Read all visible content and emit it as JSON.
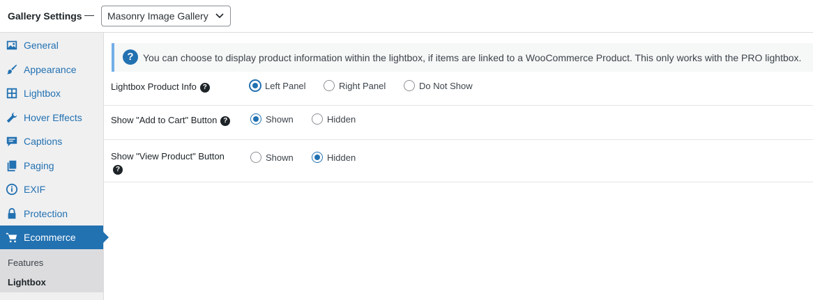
{
  "header": {
    "title": "Gallery Settings",
    "separator": "—",
    "gallery_select": {
      "value": "Masonry Image Gallery",
      "icon": "chevron-down-icon"
    }
  },
  "sidebar": {
    "items": [
      {
        "label": "General",
        "icon": "image-icon"
      },
      {
        "label": "Appearance",
        "icon": "brush-icon"
      },
      {
        "label": "Lightbox",
        "icon": "grid-icon"
      },
      {
        "label": "Hover Effects",
        "icon": "wrench-icon"
      },
      {
        "label": "Captions",
        "icon": "comment-icon"
      },
      {
        "label": "Paging",
        "icon": "pages-icon"
      },
      {
        "label": "EXIF",
        "icon": "info-icon"
      },
      {
        "label": "Protection",
        "icon": "lock-icon"
      },
      {
        "label": "Ecommerce",
        "icon": "cart-icon",
        "active": true
      }
    ],
    "submenu": [
      {
        "label": "Features"
      },
      {
        "label": "Lightbox",
        "current": true
      }
    ]
  },
  "notice": {
    "icon": "question-icon",
    "icon_glyph": "?",
    "text": "You can choose to display product information within the lightbox, if items are linked to a WooCommerce Product. This only works with the PRO lightbox."
  },
  "settings": [
    {
      "label": "Lightbox Product Info",
      "help_glyph": "?",
      "options": [
        "Left Panel",
        "Right Panel",
        "Do Not Show"
      ],
      "selected": "Left Panel"
    },
    {
      "label": "Show \"Add to Cart\" Button",
      "help_glyph": "?",
      "options": [
        "Shown",
        "Hidden"
      ],
      "selected": "Shown"
    },
    {
      "label": "Show \"View Product\" Button",
      "help_glyph": "?",
      "options": [
        "Shown",
        "Hidden"
      ],
      "selected": "Hidden"
    }
  ],
  "colors": {
    "accent": "#2271b1",
    "notice_border": "#72aee6",
    "sidebar_bg": "#f0f0f1"
  }
}
